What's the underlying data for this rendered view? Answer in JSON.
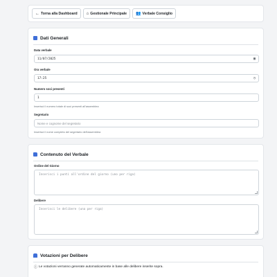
{
  "nav": {
    "buttons": [
      {
        "icon": "arrow-left-icon",
        "glyph": "←",
        "label": "Torna alla Dashboard"
      },
      {
        "icon": "home-icon",
        "glyph": "⌂",
        "label": "Gestionale Principale"
      },
      {
        "icon": "users-icon",
        "glyph": "👥",
        "label": "Verbale Consiglio"
      }
    ]
  },
  "general": {
    "title": "Dati Generali",
    "icon_color": "#3f6fd8",
    "date_label": "Data verbale",
    "date_value": "11/07/2025",
    "time_label": "Ora verbale",
    "time_value": "17:25",
    "count_label": "Numero soci presenti",
    "count_value": "1",
    "count_help": "Inserisci il numero totale di soci presenti all'assemblea",
    "secretary_label": "Segretario",
    "secretary_placeholder": "Nome e cognome del segretario",
    "secretary_help": "Inserisci il nome completo del segretario dell'assemblea"
  },
  "content": {
    "title": "Contenuto del Verbale",
    "icon_color": "#3f6fd8",
    "agenda_label": "Ordine del Giorno",
    "agenda_placeholder": "Inserisci i punti all'ordine del giorno (uno per riga)",
    "resolutions_label": "Delibere",
    "resolutions_placeholder": "Inserisci le delibere (una per riga)"
  },
  "votes": {
    "title": "Votazioni per Delibere",
    "icon_color": "#3f6fd8",
    "info_text": "Le votazioni verranno generate automaticamente in base alle delibere inserite sopra."
  }
}
